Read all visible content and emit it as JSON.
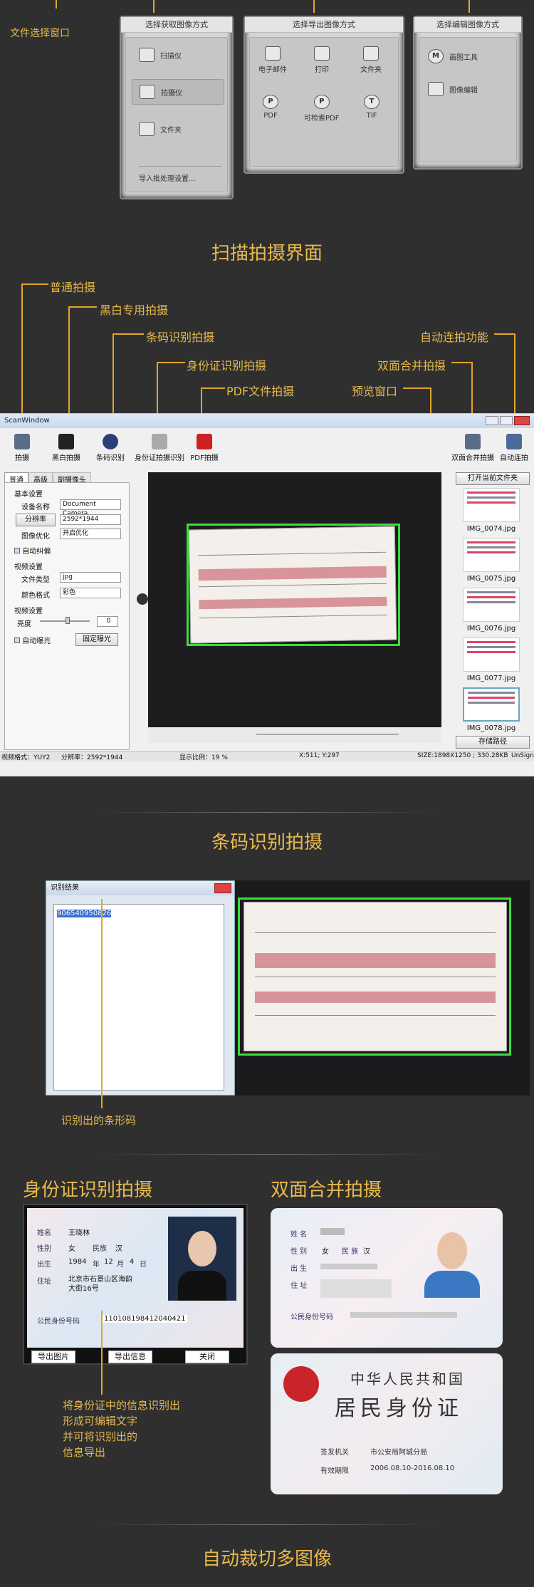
{
  "top": {
    "file_window_label": "文件选择窗口",
    "panel_acquire": {
      "title": "选择获取图像方式",
      "items": [
        "扫描仪",
        "拍摄仪",
        "文件夹"
      ],
      "batch": "导入批处理设置..."
    },
    "panel_export": {
      "title": "选择导出图像方式",
      "row1": [
        "电子邮件",
        "打印",
        "文件夹"
      ],
      "row2": [
        "PDF",
        "可检索PDF",
        "TIF"
      ],
      "row2_icons": [
        "P",
        "P",
        "T"
      ]
    },
    "panel_edit": {
      "title": "选择编辑图像方式",
      "items": [
        "画图工具",
        "图像编辑"
      ]
    }
  },
  "section1_title": "扫描拍摄界面",
  "callouts": {
    "normal": "普通拍摄",
    "bw": "黑白专用拍摄",
    "barcode": "条码识别拍摄",
    "idcard": "身份证识别拍摄",
    "pdf": "PDF文件拍摄",
    "preview": "预览窗口",
    "duplex": "双面合并拍摄",
    "auto": "自动连拍功能"
  },
  "scanwindow": {
    "title": "ScanWindow",
    "toolbar": [
      "拍摄",
      "黑白拍摄",
      "条码识别",
      "身份证拍摄识别",
      "PDF拍摄"
    ],
    "toolbar_right": [
      "双面合并拍摄",
      "自动连拍"
    ],
    "tabs": [
      "普通",
      "高级",
      "副摄像头"
    ],
    "basic_settings": "基本设置",
    "device_label": "设备名称",
    "device_value": "Document Camera",
    "resolution_button": "分辨率",
    "resolution_value": "2592*1944",
    "optimize_label": "图像优化",
    "optimize_value": "开启优化",
    "auto_crop": "自动纠偏",
    "video_settings": "视频设置",
    "filetype_label": "文件类型",
    "filetype_value": "jpg",
    "color_label": "颜色格式",
    "color_value": "彩色",
    "video_settings2": "视频设置",
    "brightness_label": "亮度",
    "brightness_value": "0",
    "auto_exposure": "自动曝光",
    "fixed_exposure": "固定曝光",
    "open_folder": "打开当前文件夹",
    "thumbs": [
      "IMG_0074.jpg",
      "IMG_0075.jpg",
      "IMG_0076.jpg",
      "IMG_0077.jpg",
      "IMG_0078.jpg"
    ],
    "save_path": "存储路径",
    "status": {
      "video_format": "视频格式：YUY2",
      "resolution": "分辨率：2592*1944",
      "scale": "显示比例：19 %",
      "coords": "X:511; Y:297",
      "size": "SIZE:1898X1250 ; 330.28KB",
      "signed": "UnSign"
    }
  },
  "section2_title": "条码识别拍摄",
  "barcode": {
    "dialog_title": "识别结果",
    "result": "906540950826",
    "caption": "识别出的条形码"
  },
  "idcard": {
    "title": "身份证识别拍摄",
    "name_label": "姓名",
    "name": "王晓林",
    "gender_label": "性别",
    "gender": "女",
    "ethnic_label": "民族",
    "ethnic": "汉",
    "birth_label": "出生",
    "birth_year": "1984",
    "year": "年",
    "birth_month": "12",
    "month": "月",
    "birth_day": "4",
    "day": "日",
    "addr_label": "住址",
    "addr": "北京市石景山区海韵大街16号",
    "id_label": "公民身份号码",
    "id": "110108198412040421",
    "buttons": [
      "导出图片",
      "导出信息",
      "关闭"
    ],
    "desc": [
      "将身份证中的信息识别出",
      "形成可编辑文字",
      "并可将识别出的",
      "信息导出"
    ]
  },
  "duplex": {
    "title": "双面合并拍摄",
    "front_labels": [
      "姓 名",
      "性 别",
      "出 生",
      "住 址"
    ],
    "gender": "女",
    "ethnic_label": "民 族",
    "ethnic": "汉",
    "id_label": "公民身份号码",
    "back_title1": "中华人民共和国",
    "back_title2": "居民身份证",
    "authority_label": "签发机关",
    "authority": "市公安局阿城分局",
    "valid_label": "有效期限",
    "valid": "2006.08.10-2016.08.10"
  },
  "section3_title": "自动裁切多图像"
}
